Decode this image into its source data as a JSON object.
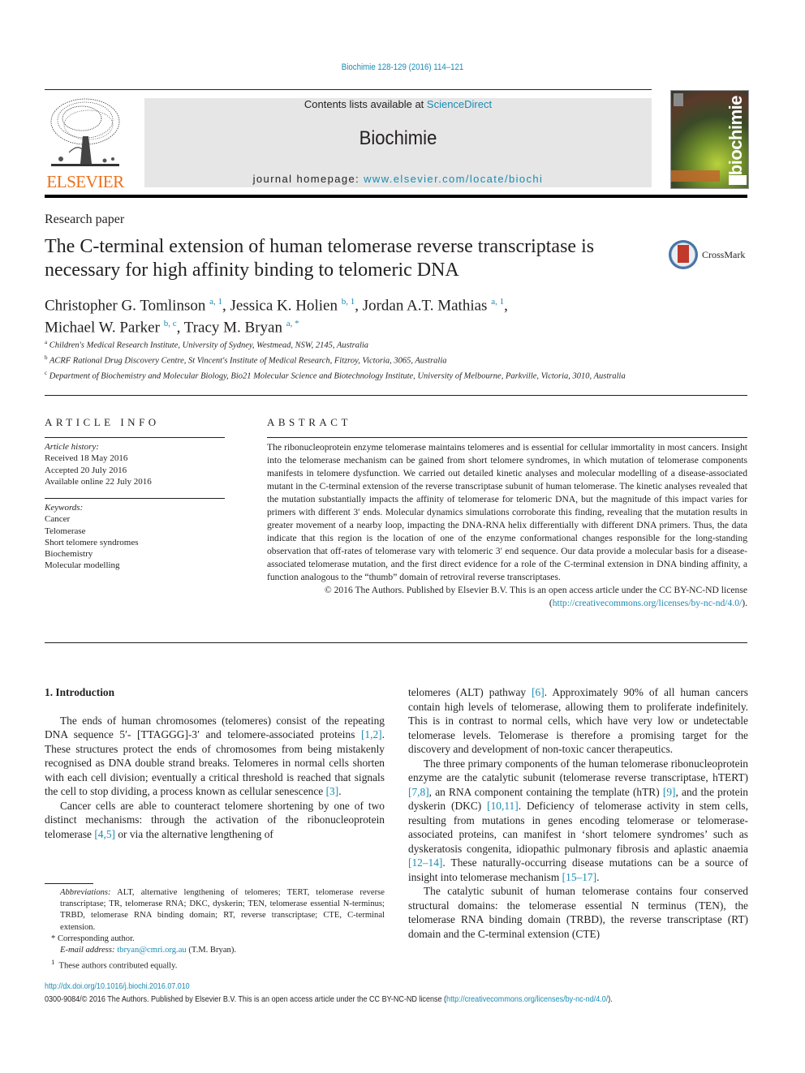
{
  "header": {
    "citation": "Biochimie 128-129 (2016) 114–121",
    "contents_prefix": "Contents lists available at ",
    "contents_link": "ScienceDirect",
    "journal_name": "Biochimie",
    "homepage_prefix": "journal homepage: ",
    "homepage_link": "www.elsevier.com/locate/biochi",
    "publisher_logo_text": "ELSEVIER",
    "cover_title": "biochimie"
  },
  "article": {
    "type": "Research paper",
    "title": "The C-terminal extension of human telomerase reverse transcriptase is necessary for high affinity binding to telomeric DNA",
    "crossmark_label": "CrossMark",
    "authors": [
      {
        "name": "Christopher G. Tomlinson",
        "sup": "a, 1",
        "sep": ", "
      },
      {
        "name": "Jessica K. Holien",
        "sup": "b, 1",
        "sep": ", "
      },
      {
        "name": "Jordan A.T. Mathias",
        "sup": "a, 1",
        "sep": ","
      },
      {
        "name": "Michael W. Parker",
        "sup": "b, c",
        "sep": ", "
      },
      {
        "name": "Tracy M. Bryan",
        "sup": "a, *",
        "sep": ""
      }
    ],
    "affiliations": [
      {
        "key": "a",
        "text": "Children's Medical Research Institute, University of Sydney, Westmead, NSW, 2145, Australia"
      },
      {
        "key": "b",
        "text": "ACRF Rational Drug Discovery Centre, St Vincent's Institute of Medical Research, Fitzroy, Victoria, 3065, Australia"
      },
      {
        "key": "c",
        "text": "Department of Biochemistry and Molecular Biology, Bio21 Molecular Science and Biotechnology Institute, University of Melbourne, Parkville, Victoria, 3010, Australia"
      }
    ]
  },
  "article_info": {
    "heading": "ARTICLE INFO",
    "history_label": "Article history:",
    "history": [
      "Received 18 May 2016",
      "Accepted 20 July 2016",
      "Available online 22 July 2016"
    ],
    "keywords_label": "Keywords:",
    "keywords": [
      "Cancer",
      "Telomerase",
      "Short telomere syndromes",
      "Biochemistry",
      "Molecular modelling"
    ]
  },
  "abstract": {
    "heading": "ABSTRACT",
    "text": "The ribonucleoprotein enzyme telomerase maintains telomeres and is essential for cellular immortality in most cancers. Insight into the telomerase mechanism can be gained from short telomere syndromes, in which mutation of telomerase components manifests in telomere dysfunction. We carried out detailed kinetic analyses and molecular modelling of a disease-associated mutant in the C-terminal extension of the reverse transcriptase subunit of human telomerase. The kinetic analyses revealed that the mutation substantially impacts the affinity of telomerase for telomeric DNA, but the magnitude of this impact varies for primers with different 3′ ends. Molecular dynamics simulations corroborate this finding, revealing that the mutation results in greater movement of a nearby loop, impacting the DNA-RNA helix differentially with different DNA primers. Thus, the data indicate that this region is the location of one of the enzyme conformational changes responsible for the long-standing observation that off-rates of telomerase vary with telomeric 3′ end sequence. Our data provide a molecular basis for a disease-associated telomerase mutation, and the first direct evidence for a role of the C-terminal extension in DNA binding affinity, a function analogous to the “thumb” domain of retroviral reverse transcriptases.",
    "copyright": "© 2016 The Authors. Published by Elsevier B.V. This is an open access article under the CC BY-NC-ND license (",
    "license_link": "http://creativecommons.org/licenses/by-nc-nd/4.0/",
    "copyright_end": ")."
  },
  "body": {
    "section_heading": "1.  Introduction",
    "left_paragraphs": [
      [
        {
          "t": "The ends of human chromosomes (telomeres) consist of the repeating DNA sequence 5′- [TTAGGG]-3′ and telomere-associated proteins "
        },
        {
          "r": "[1,2]"
        },
        {
          "t": ". These structures protect the ends of chromosomes from being mistakenly recognised as DNA double strand breaks. Telomeres in normal cells shorten with each cell division; eventually a critical threshold is reached that signals the cell to stop dividing, a process known as cellular senescence "
        },
        {
          "r": "[3]"
        },
        {
          "t": "."
        }
      ],
      [
        {
          "t": "Cancer cells are able to counteract telomere shortening by one of two distinct mechanisms: through the activation of the ribonucleoprotein telomerase "
        },
        {
          "r": "[4,5]"
        },
        {
          "t": " or via the alternative lengthening of"
        }
      ]
    ],
    "right_paragraphs": [
      [
        {
          "t": "telomeres (ALT) pathway "
        },
        {
          "r": "[6]"
        },
        {
          "t": ". Approximately 90% of all human cancers contain high levels of telomerase, allowing them to proliferate indefinitely. This is in contrast to normal cells, which have very low or undetectable telomerase levels. Telomerase is therefore a promising target for the discovery and development of non-toxic cancer therapeutics."
        }
      ],
      [
        {
          "t": "The three primary components of the human telomerase ribonucleoprotein enzyme are the catalytic subunit (telomerase reverse transcriptase, hTERT) "
        },
        {
          "r": "[7,8]"
        },
        {
          "t": ", an RNA component containing the template (hTR) "
        },
        {
          "r": "[9]"
        },
        {
          "t": ", and the protein dyskerin (DKC) "
        },
        {
          "r": "[10,11]"
        },
        {
          "t": ". Deficiency of telomerase activity in stem cells, resulting from mutations in genes encoding telomerase or telomerase-associated proteins, can manifest in ‘short telomere syndromes’ such as dyskeratosis congenita, idiopathic pulmonary fibrosis and aplastic anaemia "
        },
        {
          "r": "[12–14]"
        },
        {
          "t": ". These naturally-occurring disease mutations can be a source of insight into telomerase mechanism "
        },
        {
          "r": "[15–17]"
        },
        {
          "t": "."
        }
      ],
      [
        {
          "t": "The catalytic subunit of human telomerase contains four conserved structural domains: the telomerase essential N terminus (TEN), the telomerase RNA binding domain (TRBD), the reverse transcriptase (RT) domain and the C-terminal extension (CTE)"
        }
      ]
    ]
  },
  "footnotes": {
    "abbrev_label": "Abbreviations:",
    "abbrev_text": " ALT, alternative lengthening of telomeres; TERT, telomerase reverse transcriptase; TR, telomerase RNA; DKC, dyskerin; TEN, telomerase essential N-terminus; TRBD, telomerase RNA binding domain; RT, reverse transcriptase; CTE, C-terminal extension.",
    "corresponding": "* Corresponding author.",
    "email_label": "E-mail address:",
    "email": "tbryan@cmri.org.au",
    "email_suffix": " (T.M. Bryan).",
    "equal_marker": "1",
    "equal": "These authors contributed equally."
  },
  "footer": {
    "doi": "http://dx.doi.org/10.1016/j.biochi.2016.07.010",
    "issn_text": "0300-9084/© 2016 The Authors. Published by Elsevier B.V. This is an open access article under the CC BY-NC-ND license (",
    "license_link": "http://creativecommons.org/licenses/by-nc-nd/4.0/",
    "issn_end": ")."
  },
  "colors": {
    "link": "#1a8bb3",
    "elsevier_orange": "#e9711c",
    "masthead_bg": "#e6e6e6"
  }
}
